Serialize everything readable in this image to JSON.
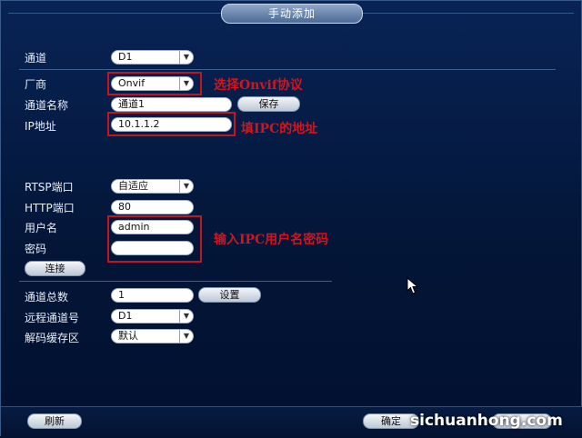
{
  "dialog": {
    "title": "手动添加"
  },
  "form": {
    "channel": {
      "label": "通道",
      "value": "D1"
    },
    "vendor": {
      "label": "厂商",
      "value": "Onvif"
    },
    "channel_name": {
      "label": "通道名称",
      "value": "通道1",
      "save_label": "保存"
    },
    "ip": {
      "label": "IP地址",
      "value": "10.1.1.2"
    },
    "rtsp_port": {
      "label": "RTSP端口",
      "value": "自适应"
    },
    "http_port": {
      "label": "HTTP端口",
      "value": "80"
    },
    "username": {
      "label": "用户名",
      "value": "admin"
    },
    "password": {
      "label": "密码",
      "value": ""
    },
    "connect_label": "连接",
    "channel_total": {
      "label": "通道总数",
      "value": "1",
      "settings_label": "设置"
    },
    "remote_channel": {
      "label": "远程通道号",
      "value": "D1"
    },
    "decode_buffer": {
      "label": "解码缓存区",
      "value": "默认"
    }
  },
  "annotations": {
    "vendor_note": "选择Onvif协议",
    "ip_note": "填IPC的地址",
    "credentials_note": "输入IPC用户名密码"
  },
  "footer": {
    "refresh_label": "刷新",
    "ok_label": "确定",
    "watermark": "sichuanhong.com"
  },
  "colors": {
    "background": "#02112b",
    "annotation_red": "#c4151c",
    "field_bg": "#ffffff"
  }
}
